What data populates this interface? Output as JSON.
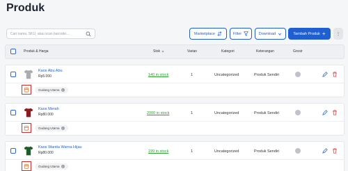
{
  "page": {
    "title": "Produk"
  },
  "toolbar": {
    "search_placeholder": "Cari nama, SKU, atau scan barcode...",
    "marketplace_label": "Marketplace",
    "filter_label": "Filter",
    "download_label": "Download",
    "add_product_label": "Tambah Produk",
    "more_label": "⋮"
  },
  "table": {
    "headers": {
      "product": "Produk & Harga",
      "stock": "Stok",
      "variants": "Varian",
      "category": "Kategori",
      "notes": "Keterangan",
      "wholesale": "Grosir"
    },
    "rows": [
      {
        "name": "Kaos Abu Abu",
        "price": "Rp5.000",
        "stock": "140 in stock",
        "variants": "1",
        "category": "Uncategorized",
        "notes": "Produk Sendiri",
        "warehouse": "Gudang Utama",
        "shirt_color": "#a9acb1"
      },
      {
        "name": "Kaos Merah",
        "price": "Rp80.000",
        "stock": "2000 in stock",
        "variants": "1",
        "category": "Uncategorized",
        "notes": "Produk Sendiri",
        "warehouse": "Gudang Utama",
        "shirt_color": "#8b1a1f"
      },
      {
        "name": "Kaos Wanita Warna Hijau",
        "price": "Rp80.000",
        "stock": "199 in stock",
        "variants": "1",
        "category": "Uncategorized",
        "notes": "Produk Sendiri",
        "warehouse": "Gudang Utama",
        "shirt_color": "#1f5a2a"
      }
    ]
  },
  "colors": {
    "primary": "#1f5fd0",
    "stock_green": "#2aa12a",
    "danger": "#d82b2b"
  }
}
